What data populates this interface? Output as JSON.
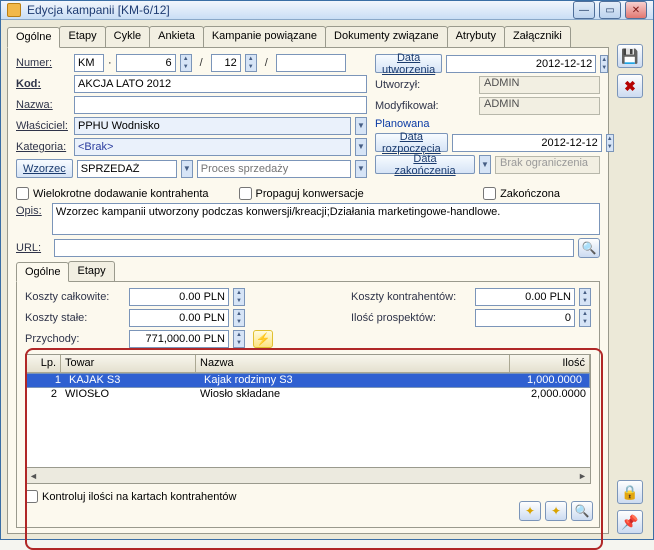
{
  "window": {
    "title": "Edycja kampanii [KM-6/12]"
  },
  "tabs": [
    "Ogólne",
    "Etapy",
    "Cykle",
    "Ankieta",
    "Kampanie powiązane",
    "Dokumenty związane",
    "Atrybuty",
    "Załączniki"
  ],
  "active_tab": 0,
  "labels": {
    "numer": "Numer:",
    "kod": "Kod:",
    "nazwa": "Nazwa:",
    "wlasciciel": "Właściciel:",
    "kategoria": "Kategoria:",
    "wzorzec": "Wzorzec",
    "proces": "Proces sprzedaży",
    "opis": "Opis:",
    "url": "URL:"
  },
  "values": {
    "num_series": "KM",
    "num_no": "6",
    "num_no2": "12",
    "kod": "AKCJA LATO 2012",
    "nazwa": "",
    "wlasciciel": "PPHU Wodnisko",
    "kategoria": "<Brak>",
    "wzorzec": "SPRZEDAŻ",
    "proces": "",
    "opis": "Wzorzec kampanii utworzony podczas konwersji/kreacji;Działania marketingowe-handlowe.",
    "url": ""
  },
  "checks": {
    "wielokrotne": "Wielokrotne dodawanie kontrahenta",
    "propaguj": "Propaguj konwersacje",
    "zakonczona": "Zakończona",
    "kontroluj": "Kontroluj ilości na kartach kontrahentów"
  },
  "right": {
    "data_utw_btn": "Data utworzenia",
    "data_utw": "2012-12-12",
    "utworzyl_lbl": "Utworzył:",
    "utworzyl": "ADMIN",
    "modyfikowal_lbl": "Modyfikował:",
    "modyfikowal": "ADMIN",
    "planowana": "Planowana",
    "data_roz_btn": "Data rozpoczęcia",
    "data_roz": "2012-12-12",
    "data_zak_btn": "Data zakończenia",
    "data_zak_placeholder": "Brak ograniczenia"
  },
  "subtabs": [
    "Ogólne",
    "Etapy"
  ],
  "costs": {
    "calk_lbl": "Koszty całkowite:",
    "calk": "0.00 PLN",
    "stale_lbl": "Koszty stałe:",
    "stale": "0.00 PLN",
    "kontrah_lbl": "Koszty kontrahentów:",
    "kontrah": "0.00 PLN",
    "ilosc_lbl": "Ilość prospektów:",
    "ilosc": "0",
    "przychody_lbl": "Przychody:",
    "przychody": "771,000.00 PLN"
  },
  "grid": {
    "headers": {
      "lp": "Lp.",
      "towar": "Towar",
      "nazwa": "Nazwa",
      "ilosc": "Ilość"
    },
    "rows": [
      {
        "lp": "1",
        "towar": "KAJAK S3",
        "nazwa": "Kajak rodzinny S3",
        "ilosc": "1,000.0000",
        "selected": true
      },
      {
        "lp": "2",
        "towar": "WIOSŁO",
        "nazwa": "Wiosło składane",
        "ilosc": "2,000.0000",
        "selected": false
      }
    ]
  },
  "icons": {
    "save": "💾",
    "cancel": "✖",
    "lock": "🔒",
    "pin": "📌",
    "search": "🔍",
    "wand1": "✦",
    "wand2": "✦",
    "url": "🔍",
    "lightning": "⚡"
  }
}
